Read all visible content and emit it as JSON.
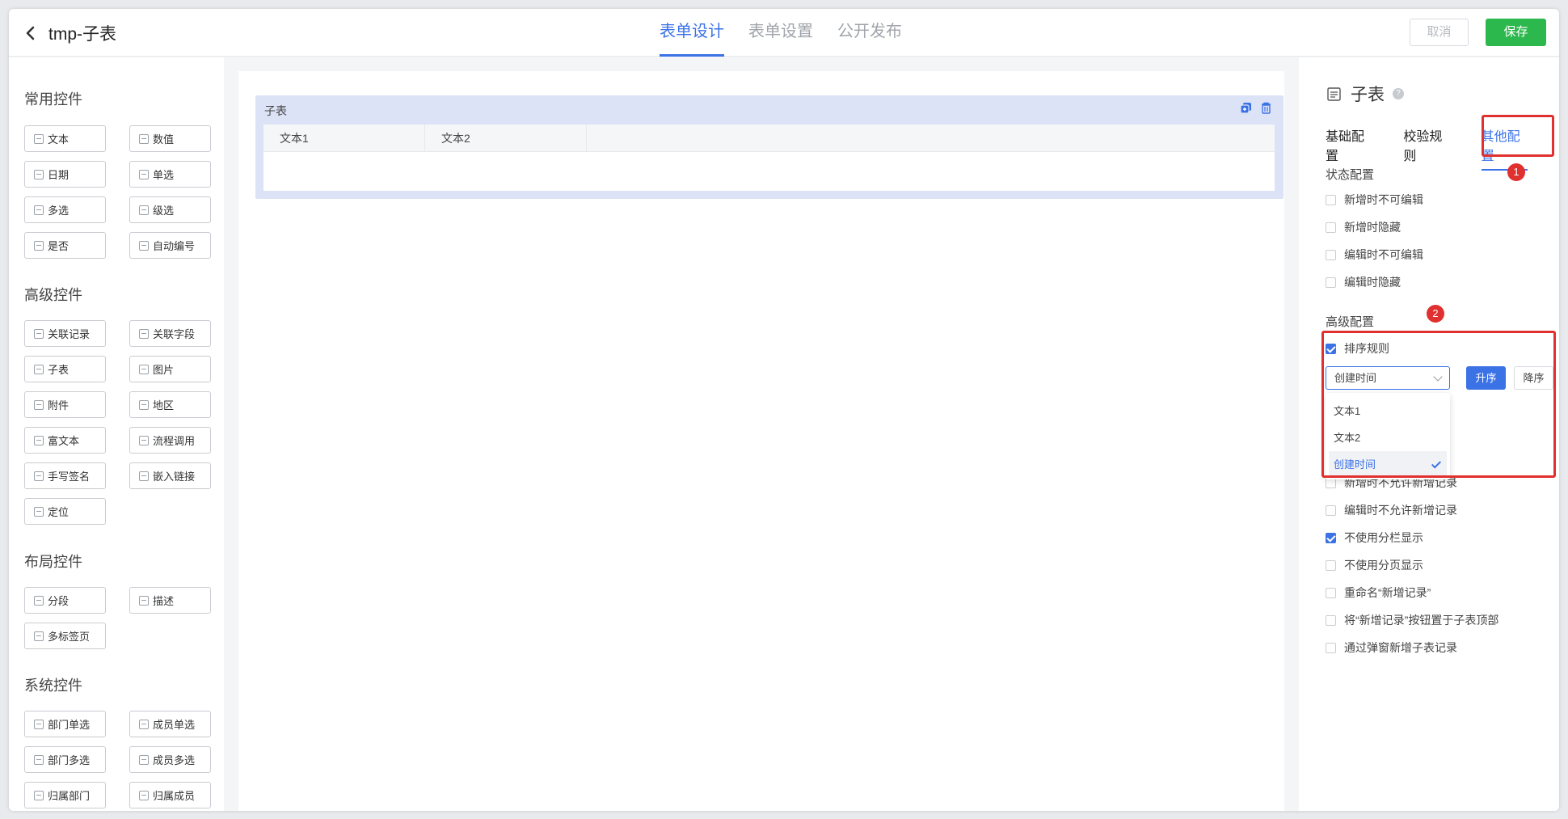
{
  "header": {
    "title": "tmp-子表",
    "tabs": [
      {
        "label": "表单设计",
        "active": true
      },
      {
        "label": "表单设置",
        "active": false
      },
      {
        "label": "公开发布",
        "active": false
      }
    ],
    "cancel_label": "取消",
    "save_label": "保存"
  },
  "left": {
    "groups": [
      {
        "title": "常用控件",
        "items": [
          "文本",
          "数值",
          "日期",
          "单选",
          "多选",
          "级选",
          "是否",
          "自动编号"
        ]
      },
      {
        "title": "高级控件",
        "items": [
          "关联记录",
          "关联字段",
          "子表",
          "图片",
          "附件",
          "地区",
          "富文本",
          "流程调用",
          "手写签名",
          "嵌入链接",
          "定位"
        ]
      },
      {
        "title": "布局控件",
        "items": [
          "分段",
          "描述",
          "多标签页"
        ]
      },
      {
        "title": "系统控件",
        "items": [
          "部门单选",
          "成员单选",
          "部门多选",
          "成员多选",
          "归属部门",
          "归属成员"
        ]
      }
    ]
  },
  "canvas": {
    "subtable_title": "子表",
    "columns": [
      "文本1",
      "文本2"
    ]
  },
  "right": {
    "title": "子表",
    "help": "?",
    "tabs": [
      {
        "label": "基础配置",
        "active": false
      },
      {
        "label": "校验规则",
        "active": false
      },
      {
        "label": "其他配置",
        "active": true
      }
    ],
    "status_section": "状态配置",
    "status_options": [
      {
        "label": "新增时不可编辑",
        "checked": false
      },
      {
        "label": "新增时隐藏",
        "checked": false
      },
      {
        "label": "编辑时不可编辑",
        "checked": false
      },
      {
        "label": "编辑时隐藏",
        "checked": false
      }
    ],
    "advanced_section": "高级配置",
    "sort_rule": {
      "label": "排序规则",
      "checked": true
    },
    "sort_select": {
      "value": "创建时间",
      "options": [
        "文本1",
        "文本2",
        "创建时间"
      ],
      "selected": "创建时间"
    },
    "asc_label": "升序",
    "desc_label": "降序",
    "hidden_partial_option": "新增时不允许新增记录",
    "advanced_options": [
      {
        "label": "编辑时不允许新增记录",
        "checked": false
      },
      {
        "label": "不使用分栏显示",
        "checked": true
      },
      {
        "label": "不使用分页显示",
        "checked": false
      },
      {
        "label": "重命名“新增记录”",
        "checked": false
      },
      {
        "label": "将“新增记录”按钮置于子表顶部",
        "checked": false
      },
      {
        "label": "通过弹窗新增子表记录",
        "checked": false
      }
    ]
  },
  "annotations": [
    "1",
    "2"
  ],
  "colors": {
    "accent": "#3b72e6",
    "save": "#2db84d",
    "annotation": "#e0302f"
  }
}
